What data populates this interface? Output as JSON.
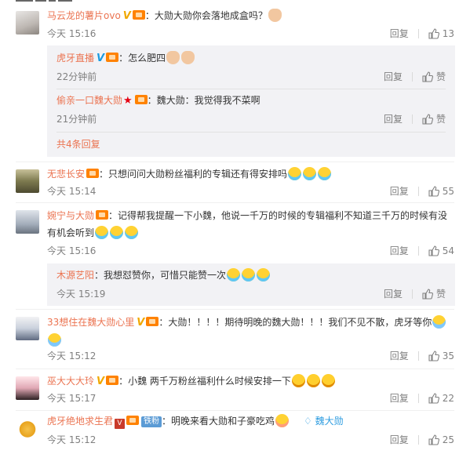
{
  "comments": [
    {
      "user": "马云龙的薯片ovo",
      "text": "：大勋大勋你会落地成盒吗？",
      "time": "今天 15:16",
      "reply_label": "回复",
      "likes": "13",
      "sub_replies": [
        {
          "user": "虎牙直播",
          "text": "：怎么肥四",
          "time": "22分钟前",
          "reply_label": "回复",
          "like_label": "赞"
        },
        {
          "user": "偷亲一口魏大勋",
          "text": "：魏大勋：我觉得我不菜啊",
          "time": "21分钟前",
          "reply_label": "回复",
          "like_label": "赞"
        }
      ],
      "more_replies": "共4条回复"
    },
    {
      "user": "无悲长安",
      "text": "：只想问问大勋粉丝福利的专辑还有得安排吗",
      "time": "今天 15:14",
      "reply_label": "回复",
      "likes": "55"
    },
    {
      "user": "婉宁与大勋",
      "text": "：记得帮我提醒一下小魏，他说一千万的时候的专辑福利不知道三千万的时候有没有机会听到",
      "time": "今天 15:16",
      "reply_label": "回复",
      "likes": "54",
      "sub_replies": [
        {
          "user": "木源艺阳",
          "text": "：我想怼赞你，可惜只能赞一次",
          "time": "今天 15:19",
          "reply_label": "回复",
          "like_label": "赞"
        }
      ]
    },
    {
      "user": "33想住在魏大勋心里",
      "text": "：大勋！！！！期待明晚的魏大勋！！！我们不见不散，虎牙等你",
      "time": "今天 15:12",
      "reply_label": "回复",
      "likes": "35"
    },
    {
      "user": "巫大大大玲",
      "text": "：小魏  两千万粉丝福利什么时候安排一下",
      "time": "今天 15:17",
      "reply_label": "回复",
      "likes": "22"
    },
    {
      "user": "虎牙绝地求生君",
      "fan_tag": "铁粉",
      "text": "：明晚来看大勋和子豪吃鸡",
      "fan_badge": "魏大勋",
      "time": "今天 15:12",
      "reply_label": "回复",
      "likes": "25"
    }
  ],
  "colors": {
    "username": "#eb7350",
    "meta": "#808080",
    "subbox": "#f2f2f5"
  }
}
